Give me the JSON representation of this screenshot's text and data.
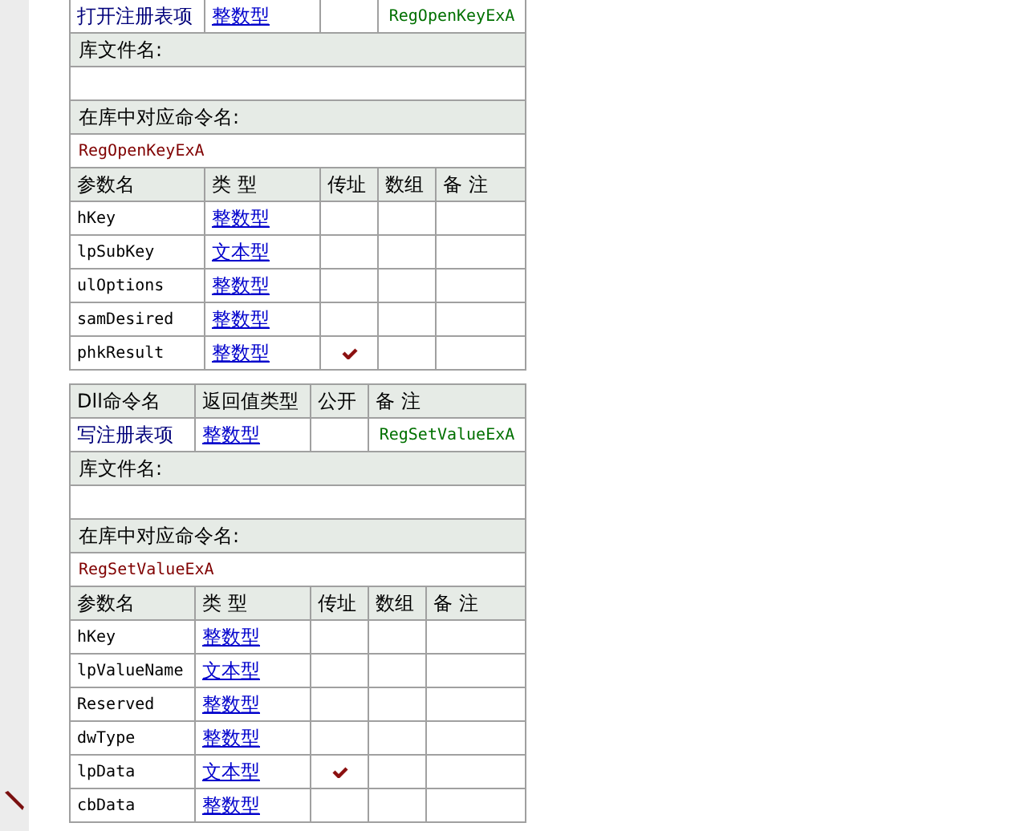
{
  "sections": [
    {
      "command": {
        "name": "打开注册表项",
        "return_type": "整数型",
        "remark": "RegOpenKeyExA"
      },
      "library_label": "库文件名:",
      "mapped_label": "在库中对应命令名:",
      "mapped_name": "RegOpenKeyExA",
      "param_headers": [
        "参数名",
        "类 型",
        "传址",
        "数组",
        "备 注"
      ],
      "params": [
        {
          "name": "hKey",
          "type": "整数型",
          "by_ref": false
        },
        {
          "name": "lpSubKey",
          "type": "文本型",
          "by_ref": false
        },
        {
          "name": "ulOptions",
          "type": "整数型",
          "by_ref": false
        },
        {
          "name": "samDesired",
          "type": "整数型",
          "by_ref": false
        },
        {
          "name": "phkResult",
          "type": "整数型",
          "by_ref": true
        }
      ]
    },
    {
      "command_headers": [
        "Dll命令名",
        "返回值类型",
        "公开",
        "备 注"
      ],
      "command": {
        "name": "写注册表项",
        "return_type": "整数型",
        "remark": "RegSetValueExA"
      },
      "library_label": "库文件名:",
      "mapped_label": "在库中对应命令名:",
      "mapped_name": "RegSetValueExA",
      "param_headers": [
        "参数名",
        "类 型",
        "传址",
        "数组",
        "备 注"
      ],
      "params": [
        {
          "name": "hKey",
          "type": "整数型",
          "by_ref": false
        },
        {
          "name": "lpValueName",
          "type": "文本型",
          "by_ref": false
        },
        {
          "name": "Reserved",
          "type": "整数型",
          "by_ref": false
        },
        {
          "name": "dwType",
          "type": "整数型",
          "by_ref": false
        },
        {
          "name": "lpData",
          "type": "文本型",
          "by_ref": true
        },
        {
          "name": "cbData",
          "type": "整数型",
          "by_ref": false
        }
      ]
    }
  ]
}
